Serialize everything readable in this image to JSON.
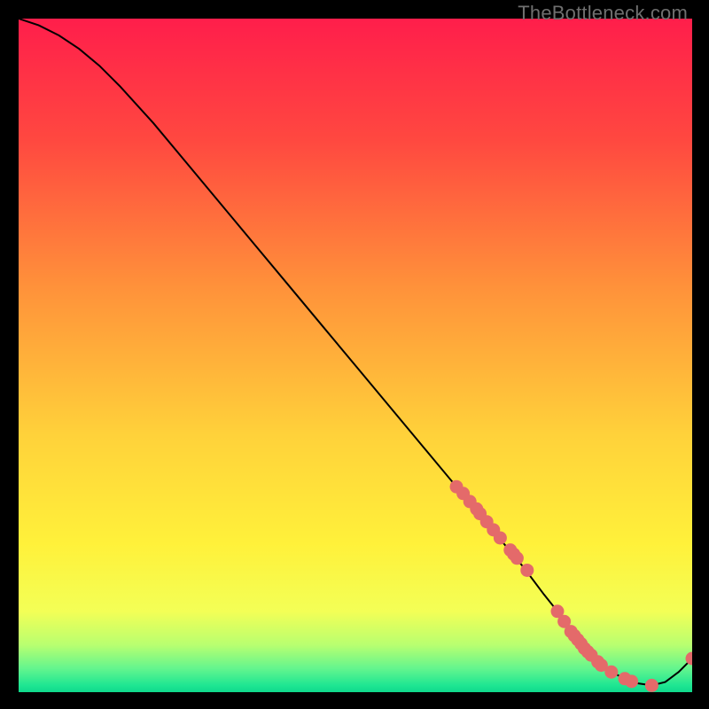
{
  "watermark": "TheBottleneck.com",
  "colors": {
    "curve": "#000000",
    "dot_fill": "#e46a6a",
    "dot_stroke": "#c25555"
  },
  "chart_data": {
    "type": "line",
    "title": "",
    "xlabel": "",
    "ylabel": "",
    "xlim": [
      0,
      100
    ],
    "ylim": [
      0,
      100
    ],
    "series": [
      {
        "name": "bottleneck-curve",
        "x": [
          0,
          3,
          6,
          9,
          12,
          15,
          20,
          25,
          30,
          35,
          40,
          45,
          50,
          55,
          60,
          65,
          70,
          75,
          78,
          80,
          82,
          84,
          86,
          88,
          90,
          92,
          94,
          96,
          98,
          100
        ],
        "values": [
          100,
          99,
          97.5,
          95.5,
          93,
          90,
          84.5,
          78.5,
          72.5,
          66.5,
          60.5,
          54.5,
          48.5,
          42.5,
          36.5,
          30.5,
          24.5,
          18.5,
          14.5,
          12,
          9,
          6.5,
          4.5,
          3,
          2,
          1.3,
          1,
          1.5,
          3,
          5
        ]
      }
    ],
    "dots": {
      "name": "highlighted-points",
      "x": [
        65,
        66,
        67,
        68,
        68.5,
        69.5,
        70.5,
        71.5,
        73,
        73.5,
        74,
        75.5,
        80,
        81,
        82,
        82.5,
        83,
        83.5,
        84,
        84.5,
        85,
        86,
        86.5,
        88,
        90,
        91,
        94,
        100
      ],
      "values": [
        30.5,
        29.5,
        28.3,
        27.2,
        26.5,
        25.3,
        24.1,
        22.9,
        21.1,
        20.5,
        19.9,
        18.1,
        12,
        10.5,
        9,
        8.4,
        7.8,
        7.2,
        6.5,
        6.0,
        5.5,
        4.5,
        4.0,
        3,
        2,
        1.6,
        1,
        5
      ]
    },
    "gradient_stops": [
      {
        "offset": 0,
        "color": "#ff1e4b"
      },
      {
        "offset": 0.18,
        "color": "#ff4840"
      },
      {
        "offset": 0.4,
        "color": "#ff923a"
      },
      {
        "offset": 0.62,
        "color": "#ffd23a"
      },
      {
        "offset": 0.78,
        "color": "#fff13a"
      },
      {
        "offset": 0.88,
        "color": "#f3ff56"
      },
      {
        "offset": 0.93,
        "color": "#b8ff70"
      },
      {
        "offset": 0.965,
        "color": "#63f58e"
      },
      {
        "offset": 0.99,
        "color": "#1ee692"
      },
      {
        "offset": 1.0,
        "color": "#0fd98c"
      }
    ]
  }
}
